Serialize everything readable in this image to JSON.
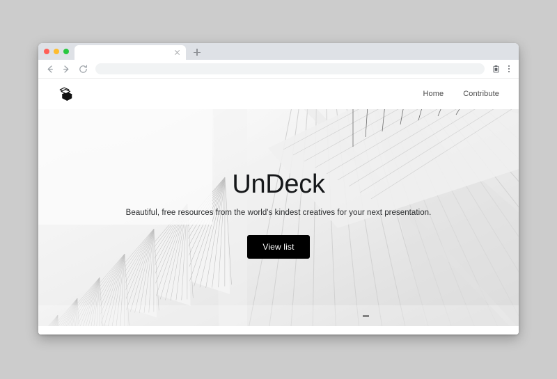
{
  "browser": {
    "traffic_lights": [
      "close",
      "minimize",
      "maximize"
    ],
    "tab": {
      "title": "",
      "close_label": "×",
      "new_tab_label": "+"
    },
    "toolbar": {
      "back_icon": "arrow-left-icon",
      "forward_icon": "arrow-right-icon",
      "reload_icon": "reload-icon",
      "address_value": "",
      "address_placeholder": "",
      "bookmark_icon": "clipboard-icon",
      "menu_icon": "kebab-menu-icon"
    }
  },
  "site": {
    "logo_alt": "undeck-logo",
    "nav": {
      "links": [
        {
          "label": "Home",
          "name": "nav-link-home"
        },
        {
          "label": "Contribute",
          "name": "nav-link-contribute"
        }
      ]
    },
    "hero": {
      "title": "UnDeck",
      "subtitle": "Beautiful, free resources from the world's kindest creatives for your next presentation.",
      "cta_label": "View list",
      "background_alt": "white-architectural-fan-ribs-photo"
    }
  },
  "colors": {
    "page_background": "#cccccc",
    "browser_chrome": "#dee1e6",
    "omnibox": "#f1f3f4",
    "cta_background": "#000000",
    "cta_text": "#ffffff",
    "title_text": "#16181a",
    "nav_link_text": "#4a4a4a",
    "traffic_red": "#ff5f57",
    "traffic_yellow": "#febc2e",
    "traffic_green": "#28c840"
  }
}
